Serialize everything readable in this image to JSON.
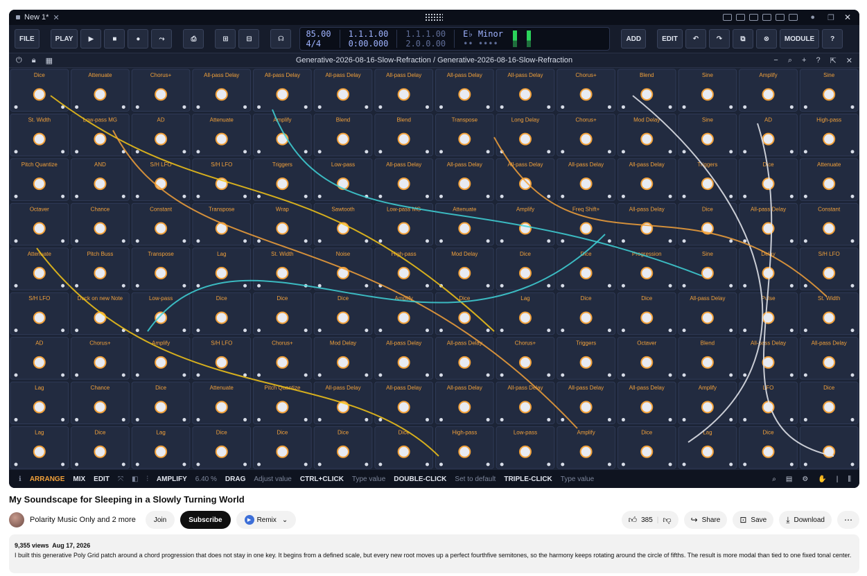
{
  "app": {
    "tab_title": "New 1*",
    "toolbar": {
      "file": "FILE",
      "play": "PLAY",
      "add": "ADD",
      "edit": "EDIT",
      "module": "MODULE",
      "help": "?"
    },
    "transport": {
      "tempo": "85.00",
      "signature": "4/4",
      "position_bars": "1.1.1.00",
      "position_time": "0:00.000",
      "loop_start": "1.1.1.00",
      "loop_end": "2.0.0.00",
      "key": "E♭ Minor"
    },
    "patch_title": "Generative-2026-08-16-Slow-Refraction / Generative-2026-08-16-Slow-Refraction",
    "rack": {
      "modules": [
        {
          "label": "Dice"
        },
        {
          "label": "Attenuate"
        },
        {
          "label": "Chorus+"
        },
        {
          "label": "All-pass Delay"
        },
        {
          "label": "All-pass Delay"
        },
        {
          "label": "All-pass Delay"
        },
        {
          "label": "All-pass Delay"
        },
        {
          "label": "All-pass Delay"
        },
        {
          "label": "All-pass Delay"
        },
        {
          "label": "Chorus+"
        },
        {
          "label": "Blend"
        },
        {
          "label": "Sine"
        },
        {
          "label": "Amplify"
        },
        {
          "label": "Sine"
        },
        {
          "label": "St. Width"
        },
        {
          "label": "Low-pass MG"
        },
        {
          "label": "AD"
        },
        {
          "label": "Attenuate"
        },
        {
          "label": "Amplify"
        },
        {
          "label": "Blend"
        },
        {
          "label": "Blend"
        },
        {
          "label": "Transpose"
        },
        {
          "label": "Long Delay"
        },
        {
          "label": "Chorus+"
        },
        {
          "label": "Mod Delay"
        },
        {
          "label": "Sine"
        },
        {
          "label": "AD"
        },
        {
          "label": "High-pass"
        },
        {
          "label": "Pitch Quantize"
        },
        {
          "label": "AND"
        },
        {
          "label": "S/H LFO"
        },
        {
          "label": "S/H LFO"
        },
        {
          "label": "Triggers"
        },
        {
          "label": "Low-pass"
        },
        {
          "label": "All-pass Delay"
        },
        {
          "label": "All-pass Delay"
        },
        {
          "label": "All-pass Delay"
        },
        {
          "label": "All-pass Delay"
        },
        {
          "label": "All-pass Delay"
        },
        {
          "label": "Triggers"
        },
        {
          "label": "Dice"
        },
        {
          "label": "Attenuate"
        },
        {
          "label": "Octaver"
        },
        {
          "label": "Chance"
        },
        {
          "label": "Constant"
        },
        {
          "label": "Transpose"
        },
        {
          "label": "Wrap"
        },
        {
          "label": "Sawtooth"
        },
        {
          "label": "Low-pass MG"
        },
        {
          "label": "Attenuate"
        },
        {
          "label": "Amplify"
        },
        {
          "label": "Freq Shift+"
        },
        {
          "label": "All-pass Delay"
        },
        {
          "label": "Dice"
        },
        {
          "label": "All-pass Delay"
        },
        {
          "label": "Constant"
        },
        {
          "label": "Attenuate"
        },
        {
          "label": "Pitch Buss"
        },
        {
          "label": "Transpose"
        },
        {
          "label": "Lag"
        },
        {
          "label": "St. Width"
        },
        {
          "label": "Noise"
        },
        {
          "label": "High-pass"
        },
        {
          "label": "Mod Delay"
        },
        {
          "label": "Dice"
        },
        {
          "label": "Dice"
        },
        {
          "label": "Progression"
        },
        {
          "label": "Sine"
        },
        {
          "label": "Delay"
        },
        {
          "label": "S/H LFO"
        },
        {
          "label": "S/H LFO"
        },
        {
          "label": "Duck on new Note"
        },
        {
          "label": "Low-pass"
        },
        {
          "label": "Dice"
        },
        {
          "label": "Dice"
        },
        {
          "label": "Dice"
        },
        {
          "label": "Amplify"
        },
        {
          "label": "Dice"
        },
        {
          "label": "Lag"
        },
        {
          "label": "Dice"
        },
        {
          "label": "Dice"
        },
        {
          "label": "All-pass Delay"
        },
        {
          "label": "Pulse"
        },
        {
          "label": "St. Width"
        },
        {
          "label": "AD"
        },
        {
          "label": "Chorus+"
        },
        {
          "label": "Amplify"
        },
        {
          "label": "S/H LFO"
        },
        {
          "label": "Chorus+"
        },
        {
          "label": "Mod Delay"
        },
        {
          "label": "All-pass Delay"
        },
        {
          "label": "All-pass Delay"
        },
        {
          "label": "Chorus+"
        },
        {
          "label": "Triggers"
        },
        {
          "label": "Octaver"
        },
        {
          "label": "Blend"
        },
        {
          "label": "All-pass Delay"
        },
        {
          "label": "All-pass Delay"
        },
        {
          "label": "Lag"
        },
        {
          "label": "Chance"
        },
        {
          "label": "Dice"
        },
        {
          "label": "Attenuate"
        },
        {
          "label": "Pitch Quantize"
        },
        {
          "label": "All-pass Delay"
        },
        {
          "label": "All-pass Delay"
        },
        {
          "label": "All-pass Delay"
        },
        {
          "label": "All-pass Delay"
        },
        {
          "label": "All-pass Delay"
        },
        {
          "label": "All-pass Delay"
        },
        {
          "label": "Amplify"
        },
        {
          "label": "LFO"
        },
        {
          "label": "Dice"
        },
        {
          "label": "Lag"
        },
        {
          "label": "Dice"
        },
        {
          "label": "Lag"
        },
        {
          "label": "Dice"
        },
        {
          "label": "Dice"
        },
        {
          "label": "Dice"
        },
        {
          "label": "Dice"
        },
        {
          "label": "High-pass"
        },
        {
          "label": "Low-pass"
        },
        {
          "label": "Amplify"
        },
        {
          "label": "Dice"
        },
        {
          "label": "Lag"
        },
        {
          "label": "Dice"
        }
      ]
    },
    "statusbar": {
      "arrange": "ARRANGE",
      "mix": "MIX",
      "edit": "EDIT",
      "amplify_label": "AMPLIFY",
      "amplify_value": "6.40 %",
      "drag_key": "DRAG",
      "drag_desc": "Adjust value",
      "ctrl_key": "CTRL+CLICK",
      "ctrl_desc": "Type value",
      "dbl_key": "DOUBLE-CLICK",
      "dbl_desc": "Set to default",
      "tri_key": "TRIPLE-CLICK",
      "tri_desc": "Type value"
    }
  },
  "video": {
    "title": "My Soundscape for Sleeping in a Slowly Turning World",
    "channel": "Polarity Music Only and 2 more",
    "join": "Join",
    "subscribe": "Subscribe",
    "remix": "Remix",
    "likes": "385",
    "share": "Share",
    "save": "Save",
    "download": "Download",
    "views": "9,355 views",
    "date": "Aug 17, 2026",
    "description": "I built this generative Poly Grid patch around a chord progression that does not stay in one key. It begins from a defined scale, but every new root moves up a perfect fourthfive semitones, so the harmony keeps rotating around the circle of fifths. The result is more modal than tied to one fixed tonal center."
  }
}
